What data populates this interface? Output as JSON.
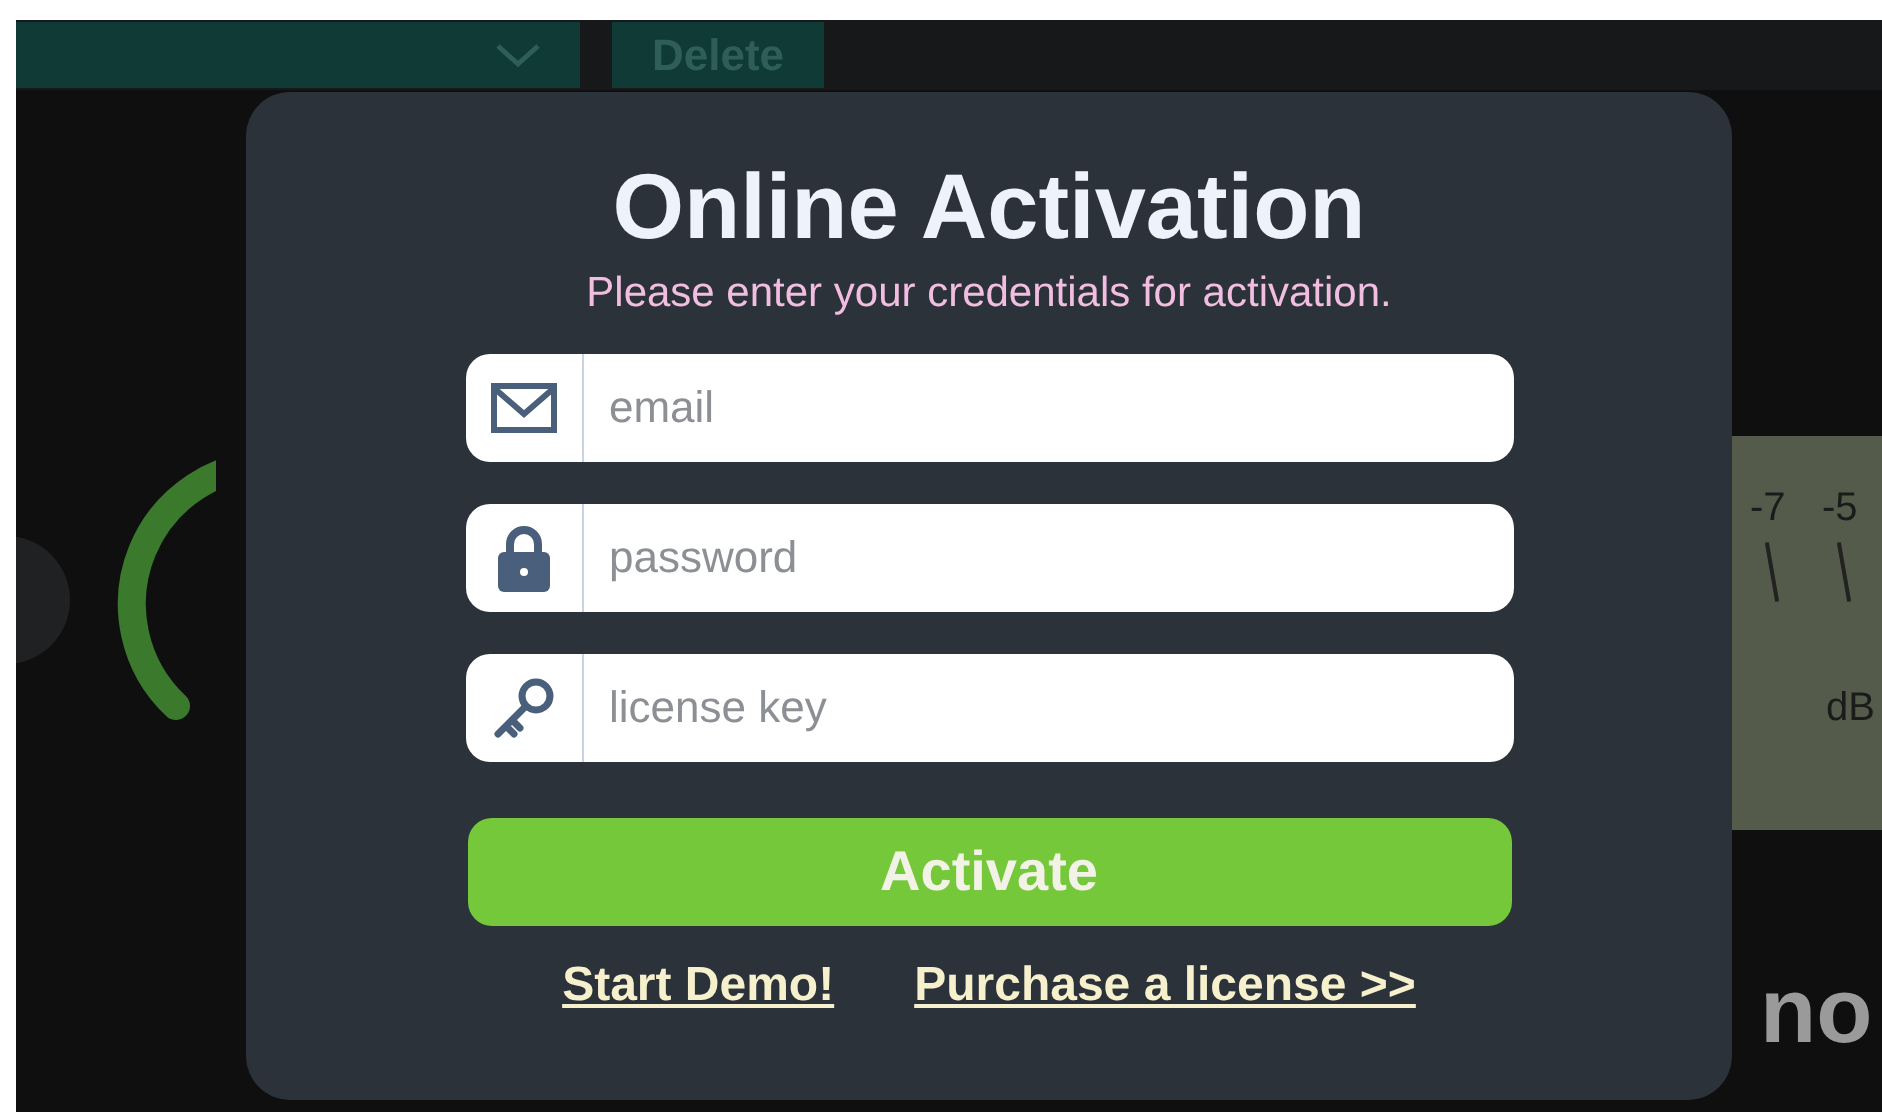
{
  "background": {
    "delete_button": "Delete",
    "meter": {
      "scale": [
        "-7",
        "-5"
      ],
      "unit": "dB"
    },
    "bottom_label": "no"
  },
  "dialog": {
    "title": "Online Activation",
    "subtitle": "Please enter your credentials for activation.",
    "fields": [
      {
        "kind": "email",
        "placeholder": "email"
      },
      {
        "kind": "password",
        "placeholder": "password"
      },
      {
        "kind": "key",
        "placeholder": "license key"
      }
    ],
    "submit": "Activate",
    "links": [
      "Start Demo!",
      "Purchase a license >>"
    ]
  }
}
